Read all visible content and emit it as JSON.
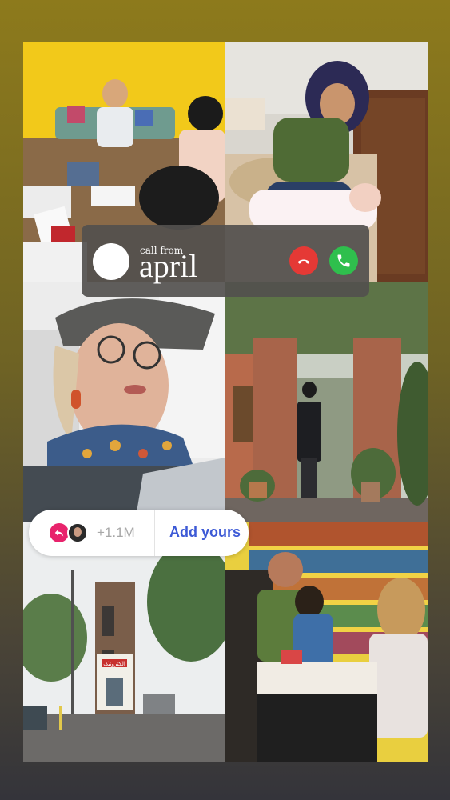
{
  "call": {
    "label": "call from",
    "caller": "april",
    "decline_icon": "phone-hangup-icon",
    "accept_icon": "phone-icon",
    "decline_color": "#e53935",
    "accept_color": "#2fbf4d"
  },
  "add_yours": {
    "count": "+1.1M",
    "button_label": "Add yours",
    "share_icon": "reply-arrow-icon",
    "share_color": "#e8236c",
    "label_color": "#3d5ad6"
  },
  "photos": [
    {
      "name": "group-at-table-photo"
    },
    {
      "name": "woman-with-baby-photo"
    },
    {
      "name": "selfie-woman-cap-photo"
    },
    {
      "name": "woman-in-garden-photo"
    },
    {
      "name": "street-view-photo",
      "sign_text": "الکترونیک"
    },
    {
      "name": "bookstore-art-class-photo"
    }
  ]
}
